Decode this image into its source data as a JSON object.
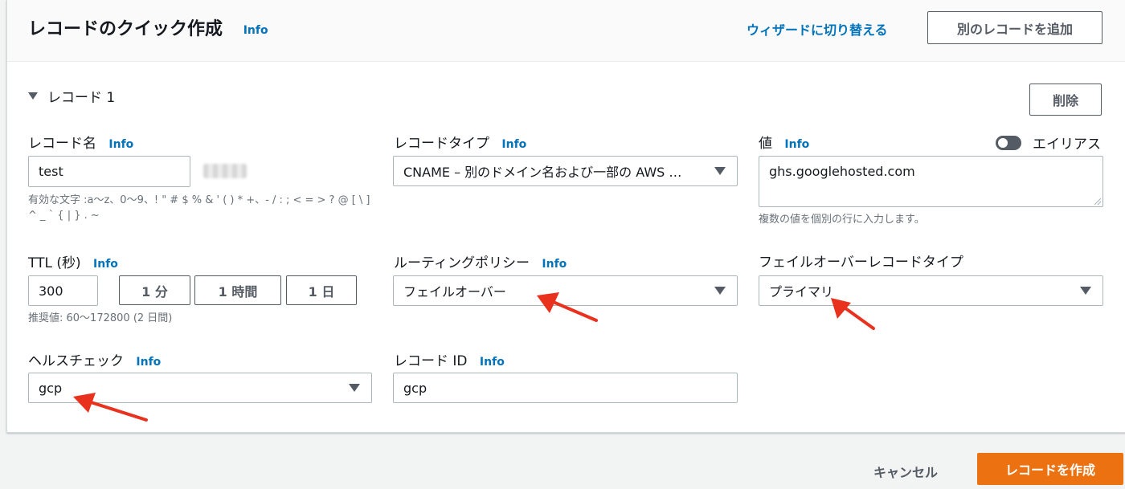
{
  "header": {
    "title": "レコードのクイック作成",
    "info": "Info",
    "wizard_link": "ウィザードに切り替える",
    "add_record_button": "別のレコードを追加"
  },
  "record": {
    "section_title": "レコード 1",
    "delete_button": "削除",
    "name": {
      "label": "レコード名",
      "info": "Info",
      "value": "test",
      "hint": "有効な文字 :a〜z、0〜9、! \" # $ % & ' ( ) * +、- / : ; < = > ? @ [ \\ ] ^ _ ` { | } . ~"
    },
    "type": {
      "label": "レコードタイプ",
      "info": "Info",
      "value": "CNAME – 別のドメイン名および一部の AWS …"
    },
    "value": {
      "label": "値",
      "info": "Info",
      "alias_label": "エイリアス",
      "value": "ghs.googlehosted.com",
      "hint": "複数の値を個別の行に入力します。"
    },
    "ttl": {
      "label": "TTL (秒)",
      "info": "Info",
      "value": "300",
      "presets": [
        "1 分",
        "1 時間",
        "1 日"
      ],
      "hint": "推奨値: 60〜172800 (2 日間)"
    },
    "routing": {
      "label": "ルーティングポリシー",
      "info": "Info",
      "value": "フェイルオーバー"
    },
    "failover_type": {
      "label": "フェイルオーバーレコードタイプ",
      "value": "プライマリ"
    },
    "health_check": {
      "label": "ヘルスチェック",
      "info": "Info",
      "value": "gcp"
    },
    "record_id": {
      "label": "レコード ID",
      "info": "Info",
      "value": "gcp"
    }
  },
  "footer": {
    "cancel": "キャンセル",
    "create": "レコードを作成"
  },
  "colors": {
    "accent": "#0073bb",
    "primary_button": "#ec7211",
    "annotation_arrow": "#e8321e"
  }
}
